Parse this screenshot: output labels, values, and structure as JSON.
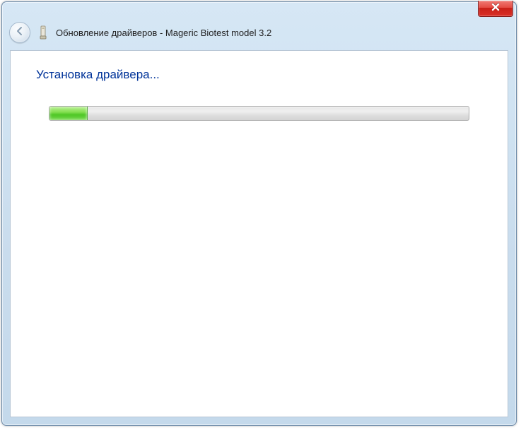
{
  "window": {
    "title": "Обновление драйверов - Mageric Biotest model 3.2"
  },
  "content": {
    "heading": "Установка драйвера..."
  },
  "progress": {
    "percent": 9
  }
}
